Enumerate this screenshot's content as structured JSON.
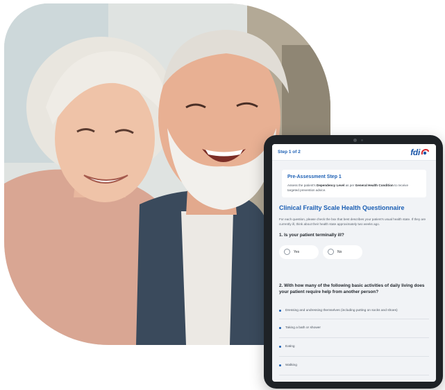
{
  "hero": {
    "image": "smiling-elderly-couple"
  },
  "tablet": {
    "step_indicator": "Step 1 of 2",
    "logo_text": "fdi",
    "pre_assessment": {
      "title": "Pre-Assessment Step 1",
      "text_a": "Assess the patient's ",
      "text_b": "Dependency Level",
      "text_c": " as per ",
      "text_d": "General Health Condition",
      "text_e": " to receive targeted prevention advice."
    },
    "questionnaire_title": "Clinical Frailty Scale Health Questionnaire",
    "intro": "For each question, please check the box that best describes your patient's usual health state. If they are currently ill, think about their health state approximately two weeks ago.",
    "q1": {
      "text": "1. Is your patient terminally ill?",
      "options": [
        "Yes",
        "No"
      ]
    },
    "q2": {
      "text": "2. With how many of the following basic activities of daily living does your patient require help from another person?",
      "activities": [
        "Dressing and undressing themselves (including putting on socks and shoes)",
        "Taking a bath or shower",
        "Eating",
        "Walking"
      ]
    }
  },
  "colors": {
    "accent": "#1b5fb4",
    "screen_bg": "#f1f3f6",
    "device": "#1e2226"
  }
}
